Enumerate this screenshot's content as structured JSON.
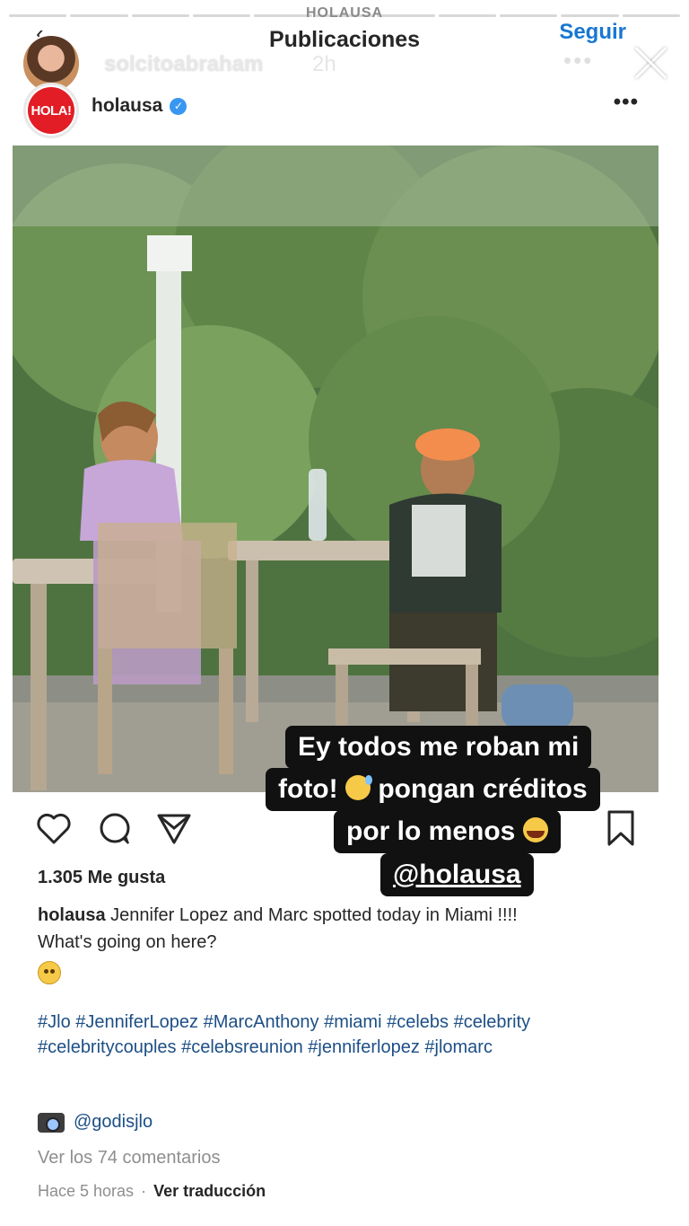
{
  "story": {
    "brand_top": "HOLAUSA",
    "header_title": "Publicaciones",
    "follow_label": "Seguir",
    "username": "solcitoabraham",
    "time": "2h",
    "more": "•••"
  },
  "post": {
    "avatar_text": "HOLA!",
    "username": "holausa",
    "more": "•••",
    "likes": "1.305 Me gusta",
    "caption_user": "holausa",
    "caption_text": "Jennifer Lopez and Marc spotted today in Miami !!!!",
    "caption_line2": "What's going on here?",
    "hashtags": "#Jlo #JenniferLopez #MarcAnthony #miami #celebs #celebrity #celebritycouples #celebsreunion #jenniferlopez #jlomarc",
    "credit": "@godisjlo",
    "comments_link": "Ver los 74 comentarios",
    "timestamp": "Hace 5 horas",
    "separator": "·",
    "translate": "Ver traducción"
  },
  "sticker": {
    "line1": "Ey todos me roban mi",
    "line2a": "foto!",
    "line2b": "pongan créditos",
    "line3": "por lo menos",
    "mention": "@holausa"
  },
  "colors": {
    "accent": "#1877d2",
    "hashtag": "#1d4f86",
    "hola_red": "#e21d26",
    "sticker_bg": "#111111"
  }
}
